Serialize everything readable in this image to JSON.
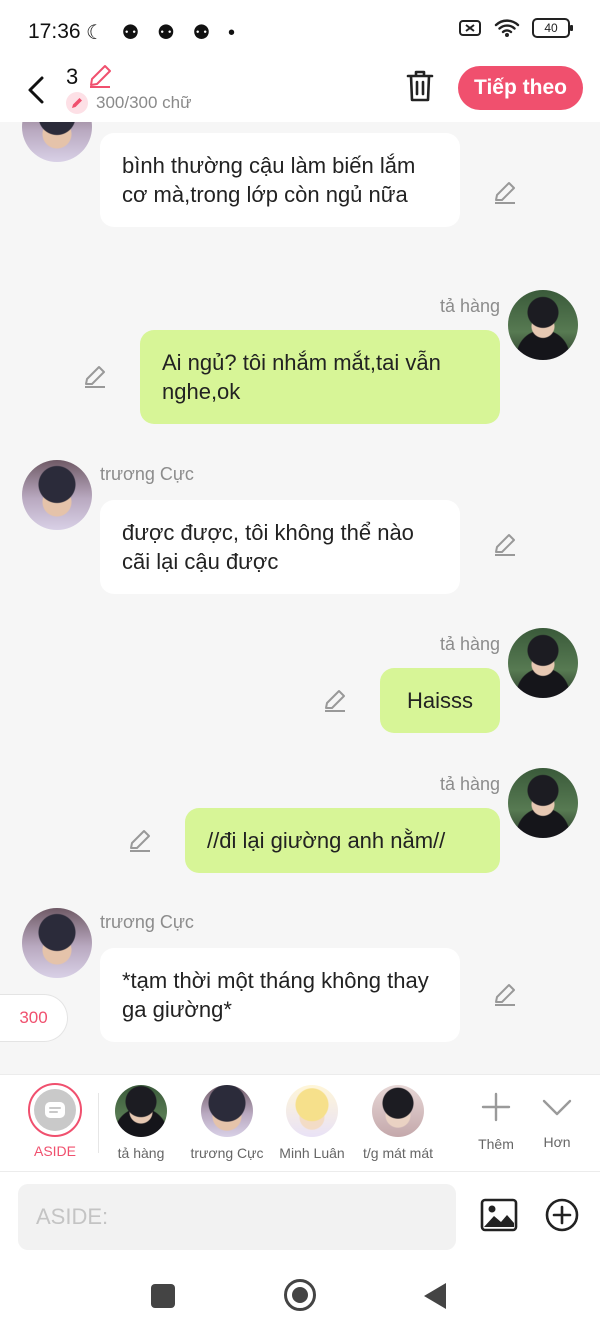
{
  "status": {
    "time": "17:36",
    "left_icons": "☾ ⚉ ⚉ ⚉ •",
    "battery": "40"
  },
  "header": {
    "count": "3",
    "char_count": "300/300 chữ",
    "next_label": "Tiếp theo"
  },
  "messages": [
    {
      "side": "left",
      "name": "",
      "text": "bình thường cậu làm biến lắm cơ mà,trong lớp còn ngủ nữa"
    },
    {
      "side": "right",
      "name": "tả hàng",
      "text": "Ai ngủ? tôi nhắm mắt,tai vẫn nghe,ok"
    },
    {
      "side": "left",
      "name": "trương Cực",
      "text": "được được, tôi không thể nào cãi lại cậu được"
    },
    {
      "side": "right",
      "name": "tả hàng",
      "text": "Haisss"
    },
    {
      "side": "right",
      "name": "tả hàng",
      "text": "//đi lại giường anh nằm//"
    },
    {
      "side": "left",
      "name": "trương Cực",
      "text": "*tạm thời một tháng không thay ga giường*"
    }
  ],
  "counter_pill": "300",
  "characters": [
    {
      "label": "ASIDE",
      "selected": true
    },
    {
      "label": "tả hàng"
    },
    {
      "label": "trương Cực"
    },
    {
      "label": "Minh Luân"
    },
    {
      "label": "t/g mát mát"
    },
    {
      "label": "Thêm"
    },
    {
      "label": "Hơn"
    }
  ],
  "input": {
    "placeholder": "ASIDE:"
  },
  "colors": {
    "accent": "#f0506e",
    "bubble_green": "#d7f597",
    "bubble_white": "#ffffff"
  }
}
